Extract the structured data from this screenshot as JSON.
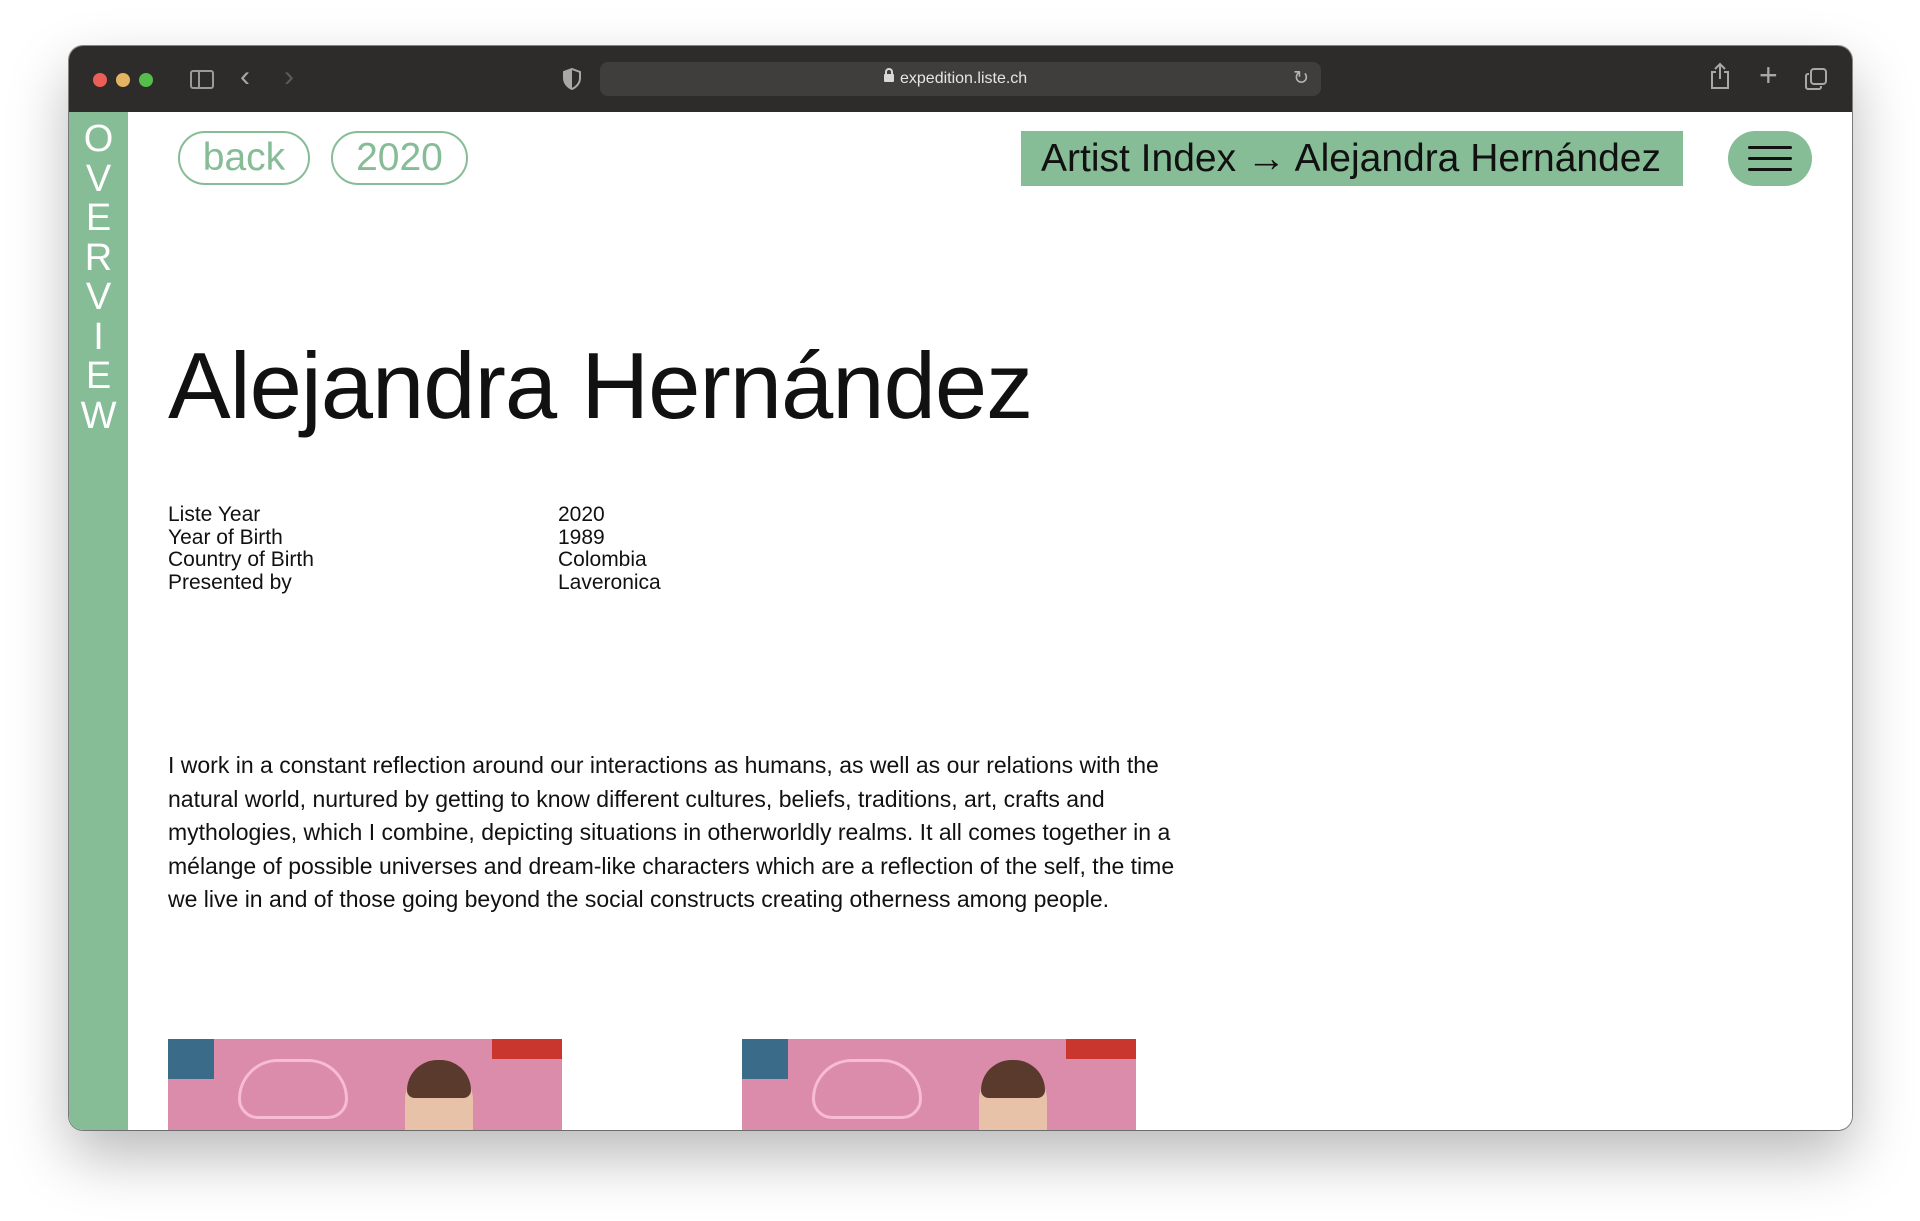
{
  "browser": {
    "url": "expedition.liste.ch"
  },
  "sidebar": {
    "letters": [
      "O",
      "V",
      "E",
      "R",
      "V",
      "I",
      "E",
      "W"
    ]
  },
  "nav": {
    "back_label": "back",
    "year_label": "2020",
    "breadcrumb": "Artist Index → Alejandra Hernández"
  },
  "artist": {
    "name": "Alejandra Hernández",
    "info": [
      {
        "label": "Liste Year",
        "value": "2020"
      },
      {
        "label": "Year of Birth",
        "value": "1989"
      },
      {
        "label": "Country of Birth",
        "value": "Colombia"
      },
      {
        "label": "Presented by",
        "value": "Laveronica"
      }
    ],
    "statement": "I work in a constant reflection around our interactions as humans, as well as our relations with the\nnatural world, nurtured by getting to know different cultures, beliefs, traditions, art, crafts and\nmythologies, which I combine, depicting situations in otherworldly realms. It all comes together in a\nmélange of possible universes and dream-like characters which are a reflection of the self, the time\nwe live in and of those going beyond the social constructs creating otherness among people."
  },
  "colors": {
    "accent": "#86bc96",
    "text": "#111111",
    "toolbar": "#2d2c2b"
  }
}
